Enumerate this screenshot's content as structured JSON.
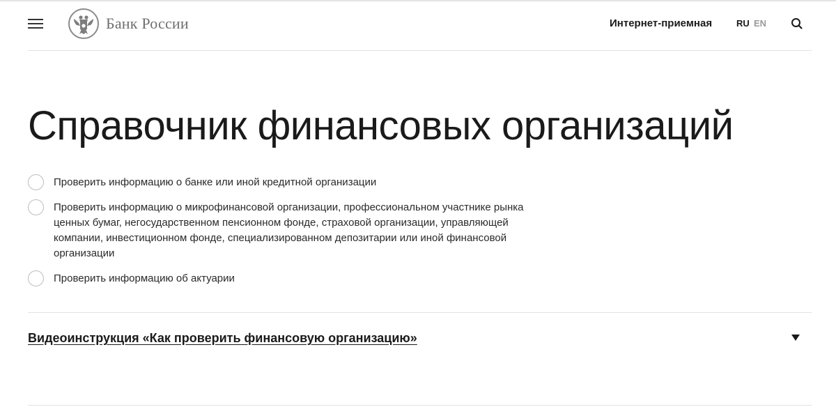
{
  "header": {
    "logo_text": "Банк России",
    "nav_link": "Интернет-приемная",
    "lang_ru": "RU",
    "lang_en": "EN",
    "icons": {
      "menu": "hamburger-icon",
      "emblem": "eagle-emblem-icon",
      "search": "search-icon"
    }
  },
  "main": {
    "title": "Справочник финансовых организаций",
    "options": [
      {
        "label": "Проверить информацию о банке или иной кредитной организации"
      },
      {
        "label": "Проверить информацию о микрофинансовой организации, профессиональном участнике рынка ценных бумаг, негосударственном пенсионном фонде, страховой организации, управляющей компании, инвестиционном фонде, специализированном депозитарии или иной финансовой организации"
      },
      {
        "label": "Проверить информацию об актуарии"
      }
    ],
    "video_instruction": "Видеоинструкция «Как проверить финансовую организацию»"
  },
  "colors": {
    "text": "#1a1a1a",
    "muted": "#9a9a9a",
    "divider": "#e2e2e2",
    "radio_border": "#bdbdbd"
  }
}
